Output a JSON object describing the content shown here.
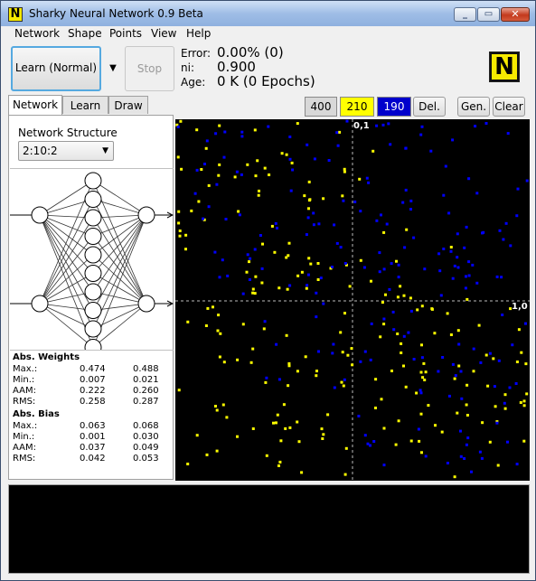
{
  "window": {
    "title": "Sharky Neural Network 0.9 Beta",
    "icon_letter": "N"
  },
  "menu": [
    "Network",
    "Shape",
    "Points",
    "View",
    "Help"
  ],
  "toolbar": {
    "learn_label": "Learn (Normal)",
    "dropdown_glyph": "▼",
    "stop_label": "Stop",
    "error_label": "Error:",
    "error_value": "0.00% (0)",
    "ni_label": "ni:",
    "ni_value": "0.900",
    "age_label": "Age:",
    "age_value": "0 K (0 Epochs)",
    "logo_letter": "N"
  },
  "tabs": [
    "Network",
    "Learn",
    "Draw"
  ],
  "network": {
    "structure_label": "Network Structure",
    "structure_value": "2:10:2",
    "layers": [
      2,
      10,
      2
    ]
  },
  "stats": {
    "weights_title": "Abs. Weights",
    "weights": [
      {
        "label": "Max.:",
        "v1": "0.474",
        "v2": "0.488"
      },
      {
        "label": "Min.:",
        "v1": "0.007",
        "v2": "0.021"
      },
      {
        "label": "AAM:",
        "v1": "0.222",
        "v2": "0.260"
      },
      {
        "label": "RMS:",
        "v1": "0.258",
        "v2": "0.287"
      }
    ],
    "bias_title": "Abs. Bias",
    "bias": [
      {
        "label": "Max.:",
        "v1": "0.063",
        "v2": "0.068"
      },
      {
        "label": "Min.:",
        "v1": "0.001",
        "v2": "0.030"
      },
      {
        "label": "AAM:",
        "v1": "0.037",
        "v2": "0.049"
      },
      {
        "label": "RMS:",
        "v1": "0.042",
        "v2": "0.053"
      }
    ]
  },
  "controls": {
    "total": "400",
    "yellow_count": "210",
    "blue_count": "190",
    "del_label": "Del.",
    "gen_label": "Gen.",
    "clear_label": "Clear"
  },
  "plot": {
    "y_axis_label": "0,1",
    "x_axis_label": "1,0",
    "colors": {
      "class_a": "#ffff00",
      "class_b": "#0000ff",
      "background": "#000000"
    }
  },
  "colors": {
    "yellow_button": "#ffff00",
    "blue_button": "#0000cc"
  }
}
